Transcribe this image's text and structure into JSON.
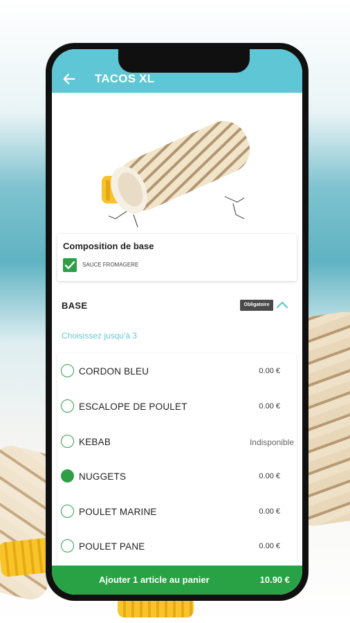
{
  "header": {
    "title": "TACOS XL",
    "back_icon": "arrow-left-icon"
  },
  "composition": {
    "title": "Composition de base",
    "items": [
      {
        "label": "SAUCE FROMAGERE",
        "checked": true
      }
    ]
  },
  "base": {
    "title": "BASE",
    "badge": "Obligatoire",
    "expand_icon": "chevron-up-icon",
    "hint": "Choisissez jusqu'à 3",
    "options": [
      {
        "name": "CORDON BLEU",
        "price": "0.00 €",
        "selected": false
      },
      {
        "name": "ESCALOPE DE POULET",
        "price": "0.00 €",
        "selected": false
      },
      {
        "name": "KEBAB",
        "price": "Indisponible",
        "selected": false
      },
      {
        "name": "NUGGETS",
        "price": "0.00 €",
        "selected": true
      },
      {
        "name": "POULET MARINE",
        "price": "0.00 €",
        "selected": false
      },
      {
        "name": "POULET PANE",
        "price": "0.00 €",
        "selected": false
      }
    ]
  },
  "cart": {
    "label": "Ajouter 1 article au panier",
    "total": "10.90 €"
  },
  "colors": {
    "accent": "#5ec6d4",
    "green": "#28a245",
    "hint": "#6ac7d1"
  }
}
